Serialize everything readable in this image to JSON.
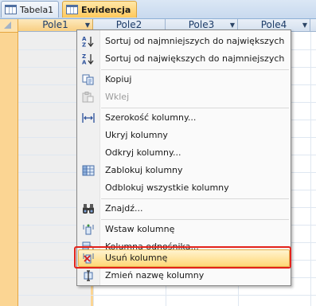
{
  "tabs": [
    {
      "label": "Tabela1",
      "icon": "table-icon",
      "active": false
    },
    {
      "label": "Ewidencja",
      "icon": "table-icon",
      "active": true
    }
  ],
  "columns": [
    {
      "label": "Pole1",
      "has_dropdown": true,
      "selected": true
    },
    {
      "label": "Pole2",
      "has_dropdown": false,
      "selected": false
    },
    {
      "label": "Pole3",
      "has_dropdown": true,
      "selected": false
    },
    {
      "label": "Pole4",
      "has_dropdown": true,
      "selected": false
    }
  ],
  "colors": {
    "selection": "#fbd593",
    "highlight": "#ffd877",
    "annotation": "#e3231b"
  },
  "context_menu": {
    "items": [
      {
        "label": "Sortuj od najmniejszych do największych",
        "icon": "sort-ascending-icon",
        "enabled": true
      },
      {
        "label": "Sortuj od największych do najmniejszych",
        "icon": "sort-descending-icon",
        "enabled": true
      },
      {
        "label": "Kopiuj",
        "icon": "copy-icon",
        "enabled": true
      },
      {
        "label": "Wklej",
        "icon": "paste-icon",
        "enabled": false
      },
      {
        "label": "Szerokość kolumny...",
        "icon": "column-width-icon",
        "enabled": true
      },
      {
        "label": "Ukryj kolumny",
        "icon": "",
        "enabled": true
      },
      {
        "label": "Odkryj kolumny...",
        "icon": "",
        "enabled": true
      },
      {
        "label": "Zablokuj kolumny",
        "icon": "freeze-columns-icon",
        "enabled": true
      },
      {
        "label": "Odblokuj wszystkie kolumny",
        "icon": "",
        "enabled": true
      },
      {
        "label": "Znajdź...",
        "icon": "binoculars-icon",
        "enabled": true
      },
      {
        "label": "Wstaw kolumnę",
        "icon": "insert-column-icon",
        "enabled": true
      },
      {
        "label": "Kolumna odnośnika...",
        "icon": "lookup-column-icon",
        "enabled": true
      },
      {
        "label": "Usuń kolumnę",
        "icon": "delete-column-icon",
        "enabled": true,
        "highlighted": true
      },
      {
        "label": "Zmień nazwę kolumny",
        "icon": "rename-column-icon",
        "enabled": true
      }
    ]
  }
}
